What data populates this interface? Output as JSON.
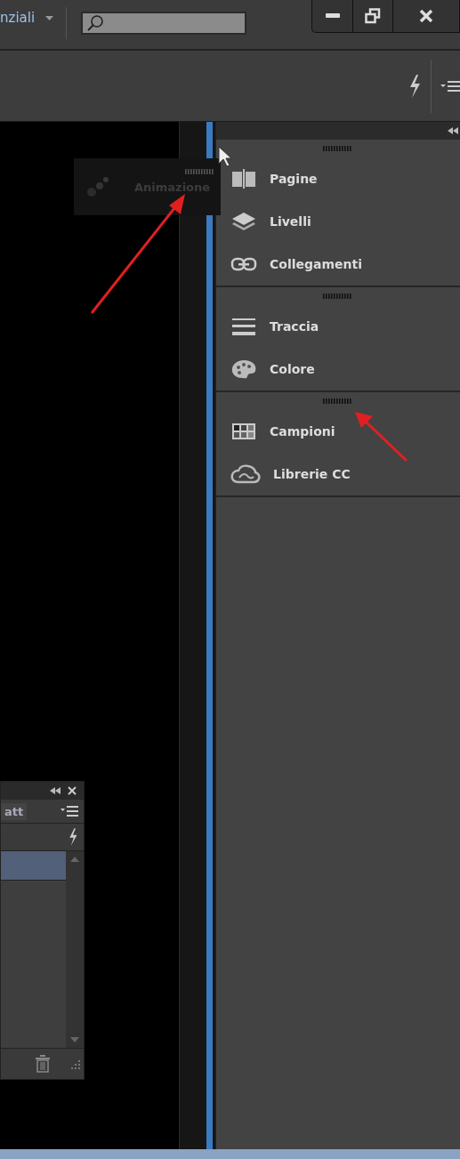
{
  "title_bar": {
    "workspace": "nziali"
  },
  "dock": {
    "groups": [
      {
        "items": [
          {
            "label": "Pagine",
            "kind": "pages"
          },
          {
            "label": "Livelli",
            "kind": "layers"
          },
          {
            "label": "Collegamenti",
            "kind": "links"
          }
        ]
      },
      {
        "items": [
          {
            "label": "Traccia",
            "kind": "stroke"
          },
          {
            "label": "Colore",
            "kind": "color"
          }
        ]
      },
      {
        "items": [
          {
            "label": "Campioni",
            "kind": "swatches"
          },
          {
            "label": "Librerie CC",
            "kind": "cc"
          }
        ]
      }
    ]
  },
  "dragged_panel": {
    "label": "Animazione"
  },
  "floating_panel": {
    "tab": "att",
    "rows": [
      {
        "selected": true
      }
    ]
  }
}
